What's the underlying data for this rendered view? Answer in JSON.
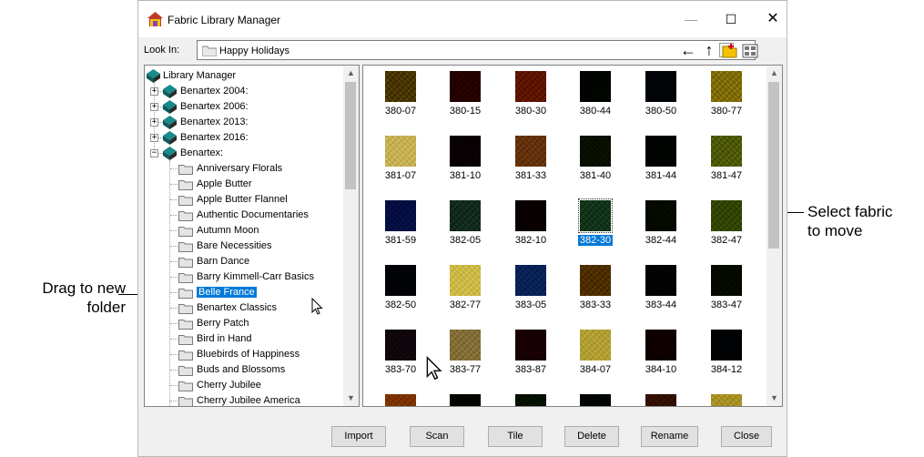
{
  "window": {
    "title": "Fabric Library Manager",
    "minimize": "—",
    "maximize": "☐",
    "close": "✕"
  },
  "lookin": {
    "label": "Look In:",
    "value": "Happy Holidays"
  },
  "toolbar": {
    "back": "←",
    "up": "↑"
  },
  "tree": {
    "root": "Library Manager",
    "collections": [
      "Benartex 2004:",
      "Benartex 2006:",
      "Benartex 2013:",
      "Benartex 2016:",
      "Benartex:"
    ],
    "folders": [
      "Anniversary Florals",
      "Apple Butter",
      "Apple Butter Flannel",
      "Authentic Documentaries",
      "Autumn Moon",
      "Bare Necessities",
      "Barn Dance",
      "Barry Kimmell-Carr Basics",
      "Belle France",
      "Benartex Classics",
      "Berry Patch",
      "Bird in Hand",
      "Bluebirds of Happiness",
      "Buds and Blossoms",
      "Cherry Jubilee",
      "Cherry Jubilee America"
    ],
    "selected_folder": "Belle France"
  },
  "fabrics": {
    "selected": "382-30",
    "rows": [
      [
        {
          "code": "380-07",
          "color": "#9a8a2a",
          "color2": "#c4b548"
        },
        {
          "code": "380-15",
          "color": "#7a2a12",
          "color2": "#a0401e"
        },
        {
          "code": "380-30",
          "color": "#a8620e",
          "color2": "#d58a1c"
        },
        {
          "code": "380-44",
          "color": "#243818",
          "color2": "#3e5a28"
        },
        {
          "code": "380-50",
          "color": "#1a3040",
          "color2": "#3a6070"
        },
        {
          "code": "380-77",
          "color": "#c0b440",
          "color2": "#e0d870"
        }
      ],
      [
        {
          "code": "381-07",
          "color": "#e6dca6",
          "color2": "#f4edc4"
        },
        {
          "code": "381-10",
          "color": "#4a2030",
          "color2": "#6a3648"
        },
        {
          "code": "381-33",
          "color": "#b08a52",
          "color2": "#d0aa72"
        },
        {
          "code": "381-40",
          "color": "#4a5a1e",
          "color2": "#6a7a30"
        },
        {
          "code": "381-44",
          "color": "#283824",
          "color2": "#3e5236"
        },
        {
          "code": "381-47",
          "color": "#a0a840",
          "color2": "#c4cc6a"
        }
      ],
      [
        {
          "code": "381-59",
          "color": "#38589a",
          "color2": "#5a7ab8"
        },
        {
          "code": "382-05",
          "color": "#5a8070",
          "color2": "#86a898"
        },
        {
          "code": "382-10",
          "color": "#4a0e16",
          "color2": "#66202a"
        },
        {
          "code": "382-30",
          "color": "#5a8a6a",
          "color2": "#88b096"
        },
        {
          "code": "382-44",
          "color": "#3a4c18",
          "color2": "#56682a"
        },
        {
          "code": "382-47",
          "color": "#8a9a30",
          "color2": "#aabb50"
        }
      ],
      [
        {
          "code": "382-50",
          "color": "#1e2c3c",
          "color2": "#304456"
        },
        {
          "code": "382-77",
          "color": "#e8e09c",
          "color2": "#f6f0bc"
        },
        {
          "code": "383-05",
          "color": "#4a78a8",
          "color2": "#6a98c8"
        },
        {
          "code": "383-33",
          "color": "#a08412",
          "color2": "#c4a82c"
        },
        {
          "code": "383-44",
          "color": "#2a3422",
          "color2": "#3e4a32"
        },
        {
          "code": "383-47",
          "color": "#3a4a16",
          "color2": "#5a6a28"
        }
      ],
      [
        {
          "code": "383-70",
          "color": "#5a4250",
          "color2": "#7a6070"
        },
        {
          "code": "383-77",
          "color": "#c4b890",
          "color2": "#ddd2ac"
        },
        {
          "code": "383-87",
          "color": "#6a1430",
          "color2": "#8a2848"
        },
        {
          "code": "384-07",
          "color": "#dcd48c",
          "color2": "#eee6aa"
        },
        {
          "code": "384-10",
          "color": "#5a1410",
          "color2": "#7a2a20"
        },
        {
          "code": "384-12",
          "color": "#1e2a34",
          "color2": "#2e3c4a"
        }
      ],
      [
        {
          "code": "",
          "color": "#c08a10",
          "color2": "#dca830"
        },
        {
          "code": "",
          "color": "#2c3a18",
          "color2": "#44562a"
        },
        {
          "code": "",
          "color": "#3a5a18",
          "color2": "#587a2c"
        },
        {
          "code": "",
          "color": "#1c3a3c",
          "color2": "#2e5456"
        },
        {
          "code": "",
          "color": "#8a5a1a",
          "color2": "#a8782e"
        },
        {
          "code": "",
          "color": "#d8cc7a",
          "color2": "#eae29c"
        }
      ]
    ]
  },
  "buttons": {
    "import": "Import",
    "scan": "Scan",
    "tile": "Tile",
    "delete": "Delete",
    "rename": "Rename",
    "close": "Close"
  },
  "callouts": {
    "left_line1": "Drag to new",
    "left_line2": "folder",
    "right_line1": "Select fabric",
    "right_line2": "to move"
  }
}
